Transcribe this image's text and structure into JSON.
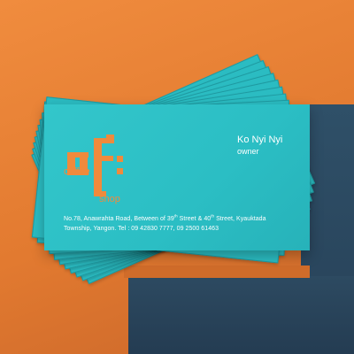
{
  "card": {
    "logo_text_left": "coffee",
    "logo_text_right": "shop",
    "name": "Ko Nyi Nyi",
    "role": "owner",
    "address_line1": {
      "p1": "No.78, Anawrahta Road, Between of 39",
      "s1": "th",
      "p2": " Street & 40",
      "s2": "th",
      "p3": " Street, Kyauktada"
    },
    "address_line2": "Township, Yangon. Tel : 09 42830 7777, 09 2500 61463"
  },
  "colors": {
    "background_orange": "#e27a30",
    "panel_navy": "#2c4a63",
    "card_teal": "#2bbec4",
    "logo_orange": "#f08a3c",
    "text_white": "#ffffff"
  }
}
